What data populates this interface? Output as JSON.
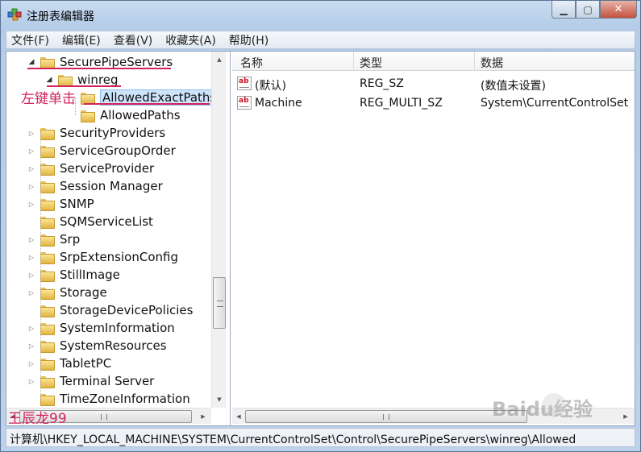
{
  "window": {
    "title": "注册表编辑器"
  },
  "menu": [
    "文件(F)",
    "编辑(E)",
    "查看(V)",
    "收藏夹(A)",
    "帮助(H)"
  ],
  "tree": [
    {
      "label": "SecurePipeServers",
      "expanded": true
    },
    {
      "label": "winreg",
      "expanded": true
    },
    {
      "label": "AllowedExactPaths",
      "selected": true
    },
    {
      "label": "AllowedPaths"
    },
    {
      "label": "SecurityProviders"
    },
    {
      "label": "ServiceGroupOrder"
    },
    {
      "label": "ServiceProvider"
    },
    {
      "label": "Session Manager"
    },
    {
      "label": "SNMP"
    },
    {
      "label": "SQMServiceList"
    },
    {
      "label": "Srp"
    },
    {
      "label": "SrpExtensionConfig"
    },
    {
      "label": "StillImage"
    },
    {
      "label": "Storage"
    },
    {
      "label": "StorageDevicePolicies"
    },
    {
      "label": "SystemInformation"
    },
    {
      "label": "SystemResources"
    },
    {
      "label": "TabletPC"
    },
    {
      "label": "Terminal Server"
    },
    {
      "label": "TimeZoneInformation"
    }
  ],
  "columns": [
    "名称",
    "类型",
    "数据"
  ],
  "values": [
    {
      "name": "(默认)",
      "type": "REG_SZ",
      "data": "(数值未设置)"
    },
    {
      "name": "Machine",
      "type": "REG_MULTI_SZ",
      "data": "System\\CurrentControlSet"
    }
  ],
  "status": "计算机\\HKEY_LOCAL_MACHINE\\SYSTEM\\CurrentControlSet\\Control\\SecurePipeServers\\winreg\\Allowed",
  "annotations": {
    "left_click": "左键单击",
    "author": "王辰龙99"
  },
  "watermark": "Baidu经验",
  "colors": {
    "annotation": "#d0245c",
    "selection": "#cde4fb"
  }
}
